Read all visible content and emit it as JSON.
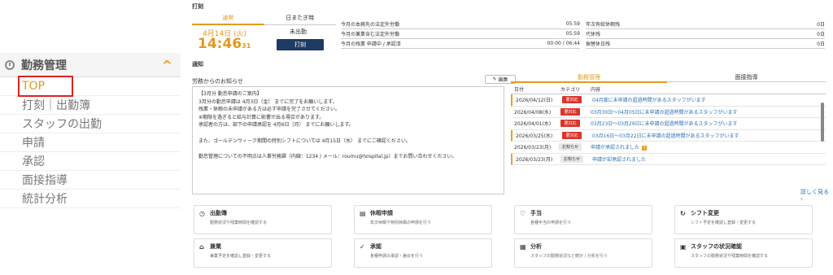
{
  "sidebar": {
    "title": "勤務管理",
    "items": [
      "TOP",
      "打刻｜出勤簿",
      "スタッフの出勤",
      "申請",
      "承認",
      "面接指導",
      "統計分析"
    ]
  },
  "dakoku": {
    "section": "打刻",
    "tab_active": "通常",
    "tab_other": "日またぎ時",
    "date": "4月14日 (火)",
    "time": "14:46",
    "seconds": "31",
    "state": "未出勤",
    "button": "打刻"
  },
  "stats_left": [
    {
      "label": "今月の本務先の法定外労働",
      "value": "05:59"
    },
    {
      "label": "今月の兼業含む法定外労働",
      "value": "05:59"
    },
    {
      "label": "今月の残業 申請中 / 承認済",
      "value": "00:00 / 06:44"
    }
  ],
  "stats_right": [
    {
      "label": "年次有給休暇残",
      "value": "0日"
    },
    {
      "label": "代休残",
      "value": "0日"
    },
    {
      "label": "振替休日残",
      "value": "0日"
    }
  ],
  "notice": {
    "section": "通知",
    "header": "労務からのお知らせ",
    "edit": "編集",
    "lines": [
      "【3月分 勤怠申請のご案内】",
      "3月分の勤怠申請は 4月3日（金） までに完了をお願いします。",
      "残業・休暇の未申請がある方は必ず申請を完了させてください。",
      "※期限を過ぎると給与計算に影響が出る場合があります。",
      "承認者の方は、部下の申請承認を 4月6日（月） までにお願いします。",
      "",
      "また、ゴールデンウィーク期間の特別シフトについては 4月15日（水） までにご確認ください。",
      "",
      "勤怠管理についての不明点は人事労務課（内線：1234 / メール：roumu@hospital.jp）までお問い合わせください。"
    ]
  },
  "alerts": {
    "tab_active": "勤務管理",
    "tab_other": "面接指導",
    "col_date": "日付",
    "col_cat": "カテゴリ",
    "col_content": "内容",
    "more": "詳しく見る",
    "rows": [
      {
        "date": "2026/04/12(日)",
        "cat": "要対応",
        "text": "04月度に未申請の超過時間があるスタッフがいます",
        "mark": true
      },
      {
        "date": "2026/04/08(水)",
        "cat": "要対応",
        "text": "03月30日〜04月05日に未申請の超過時間があるスタッフがいます",
        "mark": false
      },
      {
        "date": "2026/04/01(水)",
        "cat": "要対応",
        "text": "03月23日〜03月29日に未申請の超過時間があるスタッフがいます",
        "mark": false
      },
      {
        "date": "2026/03/25(水)",
        "cat": "要対応",
        "text": "03月16日〜03月22日に未申請の超過時間があるスタッフがいます",
        "mark": true
      },
      {
        "date": "2026/03/23(月)",
        "cat": "お知らせ",
        "text": "申請が承認されました",
        "mark": false,
        "new": "!"
      },
      {
        "date": "2026/03/23(月)",
        "cat": "お知らせ",
        "text": "申請が却承認されました",
        "mark": true
      }
    ]
  },
  "cards": [
    {
      "icon": "◷",
      "title": "出勤簿",
      "desc": "勤務状況や残業時間を確認する"
    },
    {
      "icon": "▤",
      "title": "休暇申請",
      "desc": "年次休暇や特別休暇の申請を行う"
    },
    {
      "icon": "♡",
      "title": "手当",
      "desc": "各種手当の申請を行う"
    },
    {
      "icon": "↻",
      "title": "シフト変更",
      "desc": "シフト予定を確認し登録・変更する"
    },
    {
      "icon": "⌂",
      "title": "兼業",
      "desc": "兼業予定を確認し登録・変更する"
    },
    {
      "icon": "✓",
      "title": "承認",
      "desc": "各種申請の承認・差戻を行う"
    },
    {
      "icon": "▦",
      "title": "分析",
      "desc": "スタッフの勤務状況など統計 / 分析を行う"
    },
    {
      "icon": "▣",
      "title": "スタッフの状況確認",
      "desc": "スタッフの勤務状況や残業時間を確認する"
    }
  ]
}
